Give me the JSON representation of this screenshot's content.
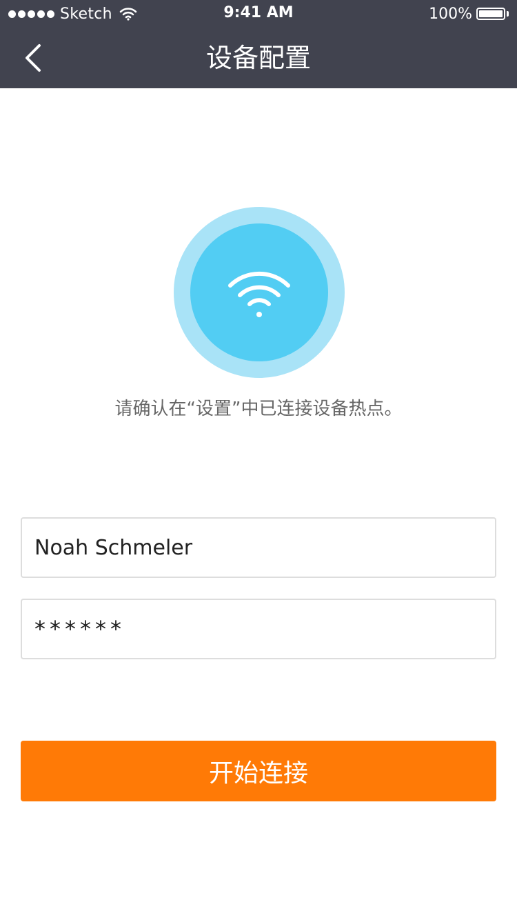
{
  "status_bar": {
    "carrier": "Sketch",
    "time": "9:41 AM",
    "battery": "100%",
    "icons": [
      "signal-dots-icon",
      "wifi-icon",
      "battery-icon"
    ]
  },
  "nav": {
    "title": "设备配置",
    "back_icon": "chevron-left-icon"
  },
  "main": {
    "wifi_icon": "wifi-icon",
    "hint": "请确认在“设置”中已连接设备热点。",
    "ssid_value": "Noah Schmeler",
    "password_value": "******",
    "connect_label": "开始连接"
  },
  "colors": {
    "header_bg": "#41434f",
    "circle_outer": "#a9e3f7",
    "circle_inner": "#52cdf3",
    "button_bg": "#ff7a06"
  }
}
